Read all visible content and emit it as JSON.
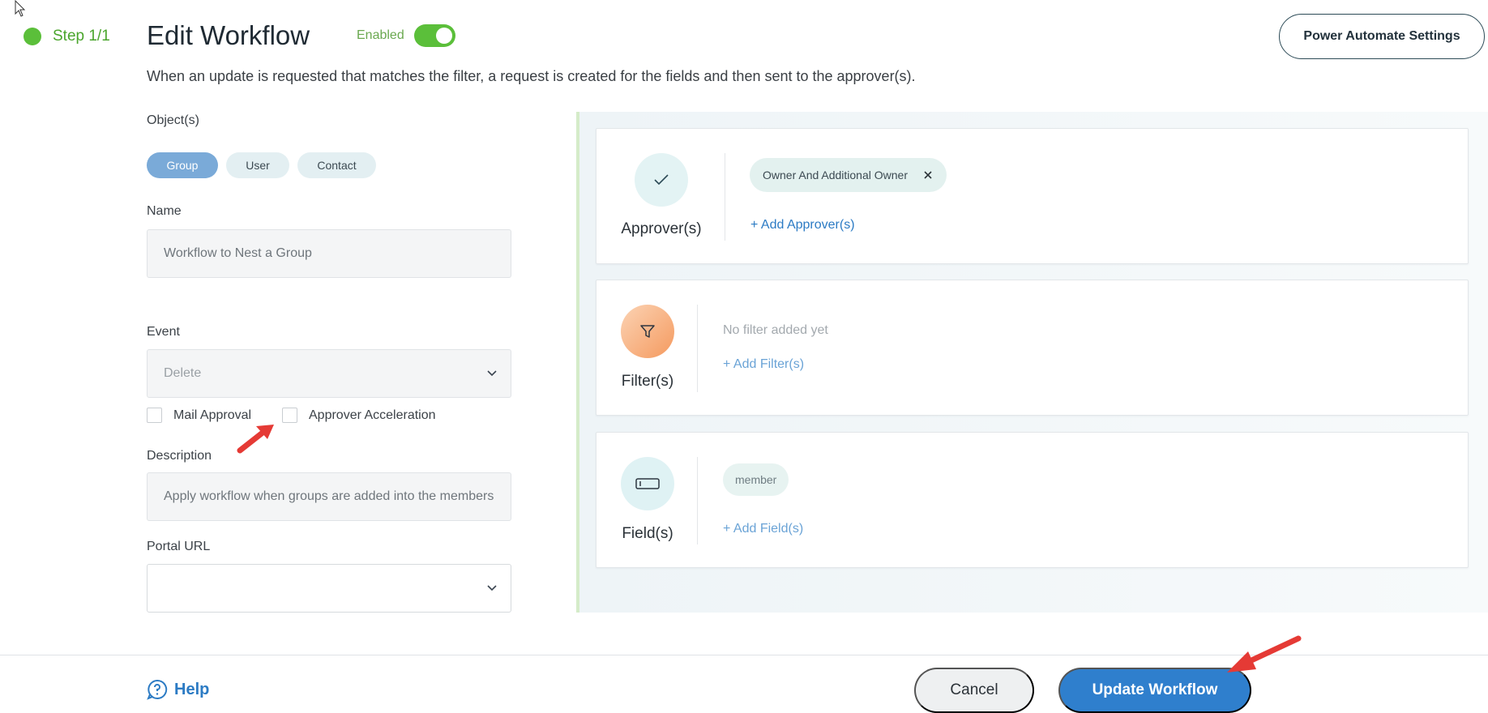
{
  "colors": {
    "accent_green": "#5bbf3a",
    "primary_blue": "#2f7fcd",
    "annotation_red": "#e53a35"
  },
  "step": {
    "label": "Step 1/1"
  },
  "header": {
    "title": "Edit Workflow",
    "enabled_label": "Enabled",
    "enabled_state": true,
    "power_automate_button": "Power Automate Settings",
    "subtitle": "When an update is requested that matches the filter, a request is created for the fields and then sent to the approver(s)."
  },
  "form": {
    "objects_label": "Object(s)",
    "objects": [
      {
        "label": "Group",
        "selected": true
      },
      {
        "label": "User",
        "selected": false
      },
      {
        "label": "Contact",
        "selected": false
      }
    ],
    "name_label": "Name",
    "name_value": "Workflow to Nest a Group",
    "event_label": "Event",
    "event_value": "Delete",
    "mail_approval_label": "Mail Approval",
    "mail_approval_checked": false,
    "approver_acceleration_label": "Approver Acceleration",
    "approver_acceleration_checked": false,
    "description_label": "Description",
    "description_value": "Apply workflow when groups are added into the members",
    "portal_url_label": "Portal URL",
    "portal_url_value": ""
  },
  "cards": {
    "approvers": {
      "label": "Approver(s)",
      "icon": "checkmark-icon",
      "chip": "Owner And Additional Owner",
      "add_link": "+ Add Approver(s)"
    },
    "filters": {
      "label": "Filter(s)",
      "icon": "funnel-icon",
      "empty_text": "No filter added yet",
      "add_link": "+ Add Filter(s)"
    },
    "fields": {
      "label": "Field(s)",
      "icon": "field-box-icon",
      "chip": "member",
      "add_link": "+ Add Field(s)"
    }
  },
  "footer": {
    "help_label": "Help",
    "cancel_label": "Cancel",
    "update_label": "Update Workflow"
  }
}
